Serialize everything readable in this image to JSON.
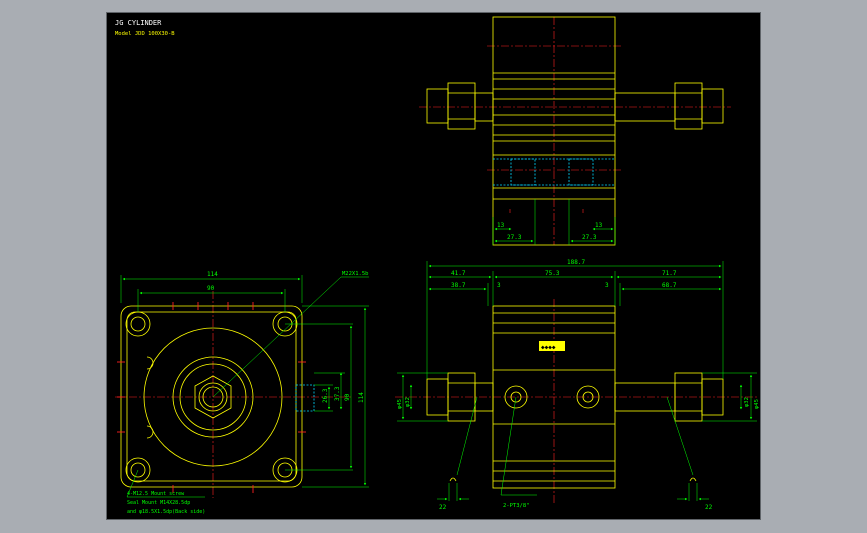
{
  "title": "JG CYLINDER",
  "model": "Model  JDD 100X30-B",
  "colors": {
    "background": "#000000",
    "outline": "#ffff00",
    "dimension": "#00ff00",
    "centerline": "#ff2020",
    "hidden": "#00d8ff",
    "frame_bg": "#a9adb3"
  },
  "top_view": {
    "dims": {
      "d1": "13",
      "d2": "13",
      "d3": "27.3",
      "d4": "27.3"
    }
  },
  "front_view": {
    "dims": {
      "overall_width": "114",
      "bolt_spacing": "90",
      "port_thread": "M22X1.5b",
      "h1": "26.3",
      "h2": "37.3",
      "h3": "90",
      "h4": "114"
    },
    "notes": [
      "4-M12.5 Mount screw",
      "Seal Mount  M14X28.5dp",
      "and φ18.5X1.5dp(Back side)"
    ]
  },
  "side_view": {
    "dims": {
      "overall": "188.7",
      "left": "41.7",
      "middle": "75.3",
      "right": "71.7",
      "left2": "38.7",
      "gap_l": "3",
      "gap_r": "3",
      "right2": "68.7",
      "left_dia": "φ45",
      "left_dia2": "φ32",
      "right_dia": "φ45",
      "right_dia2": "φ32",
      "bot_l": "22",
      "bot_r": "22",
      "port": "2-PT3/8\""
    },
    "stamp": "◆◆◆◆"
  }
}
